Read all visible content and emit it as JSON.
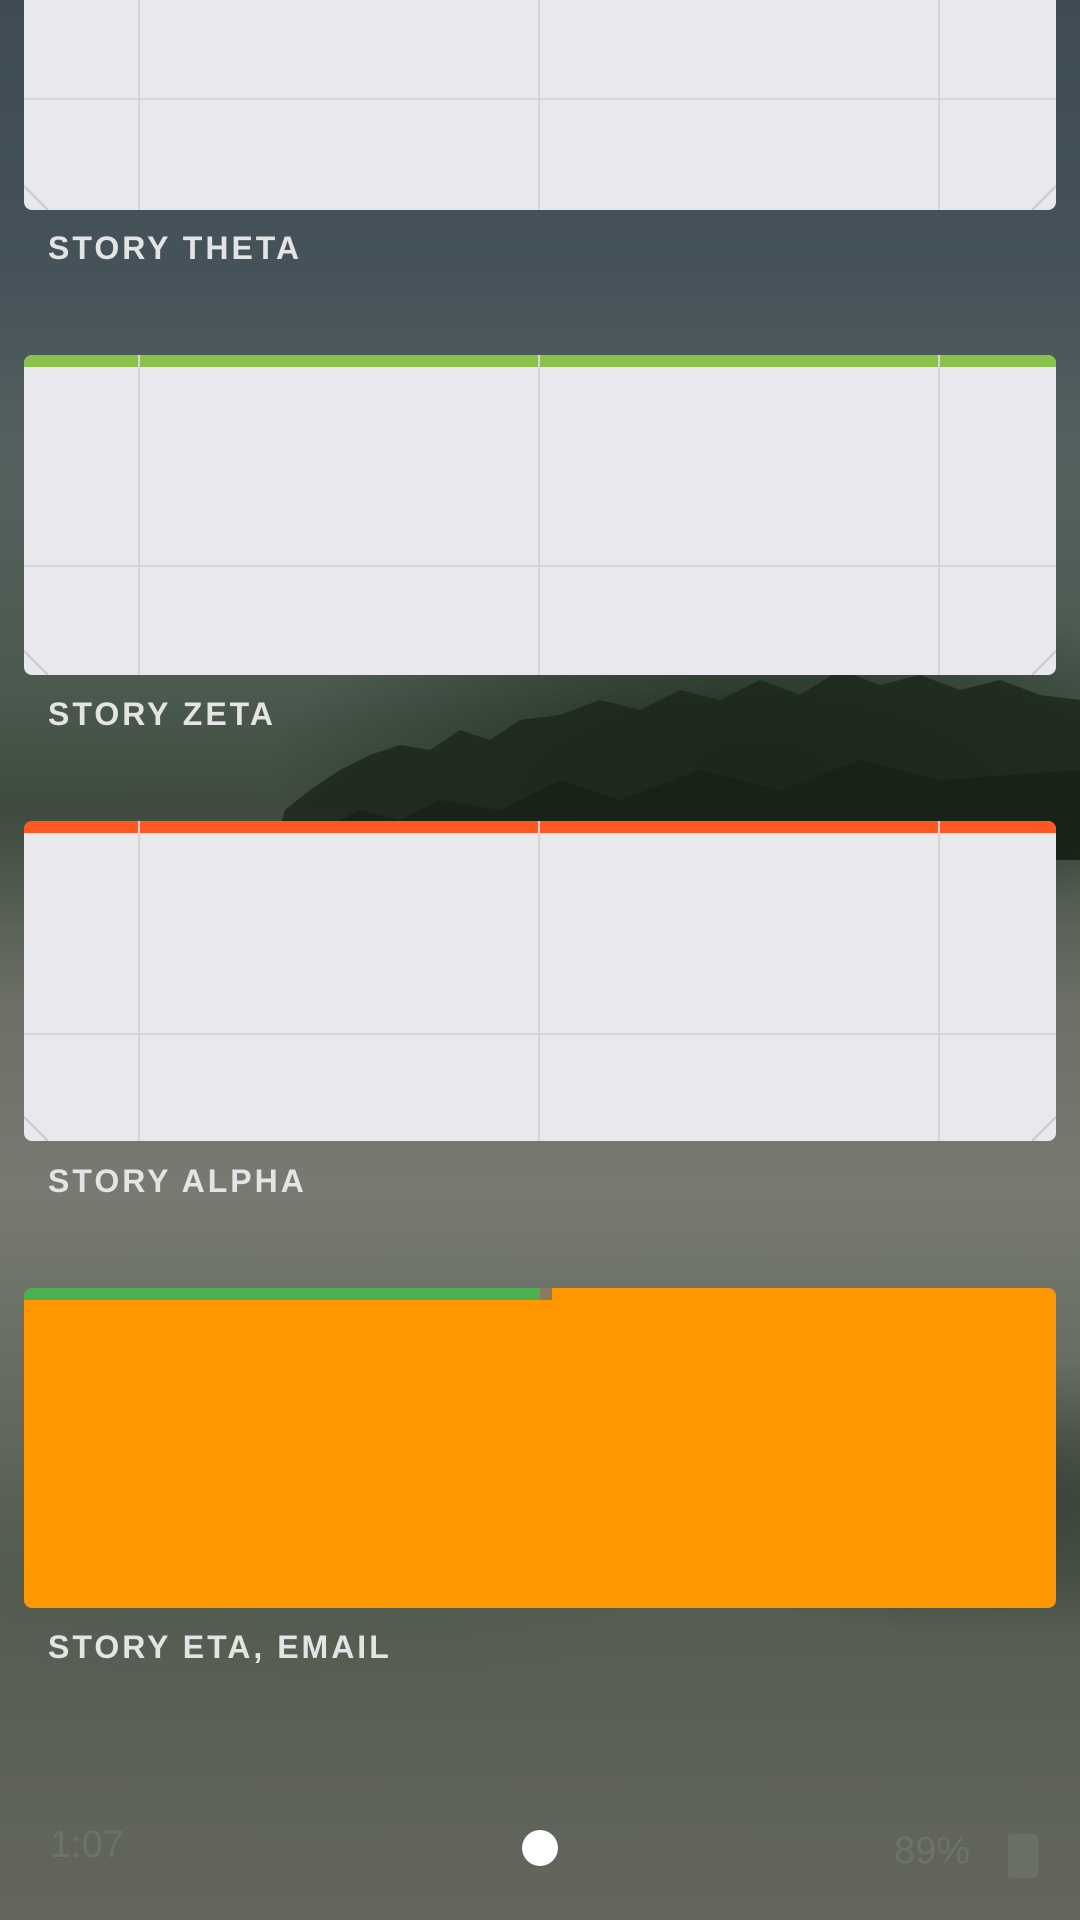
{
  "cards": [
    {
      "label": "STORY THETA",
      "type": "widget",
      "accent": ""
    },
    {
      "label": "STORY ZETA",
      "type": "widget",
      "accent": "#8bc34a"
    },
    {
      "label": "STORY ALPHA",
      "type": "widget",
      "accent": "#ff5722"
    },
    {
      "label": "STORY ETA, EMAIL",
      "type": "solid",
      "color": "#ff9800",
      "progress_color": "#4caf50",
      "progress": 0.5
    }
  ],
  "status": {
    "time": "1:07",
    "battery": "89%",
    "battery_icon": "battery-icon"
  },
  "pager": {
    "pages": 1,
    "current": 1
  }
}
